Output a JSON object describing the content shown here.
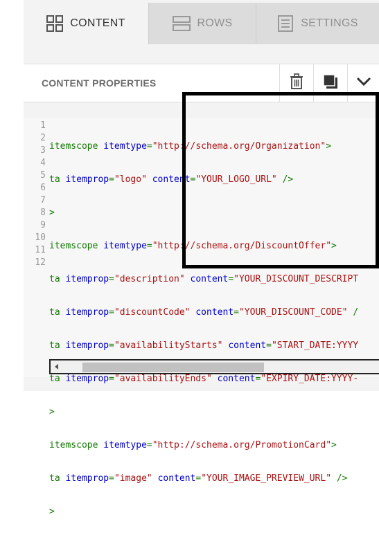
{
  "tabs": [
    {
      "label": "CONTENT",
      "icon": "grid-icon",
      "active": true
    },
    {
      "label": "ROWS",
      "icon": "rows-icon",
      "active": false
    },
    {
      "label": "SETTINGS",
      "icon": "settings-doc-icon",
      "active": false
    }
  ],
  "header": {
    "title": "CONTENT PROPERTIES",
    "buttons": [
      "trash-icon",
      "duplicate-icon",
      "chevron-down-icon"
    ]
  },
  "editor": {
    "line_numbers": [
      "1",
      "2",
      "3",
      "4",
      "5",
      "6",
      "7",
      "8",
      "9",
      "10",
      "11",
      "12"
    ],
    "lines": [
      "itemscope itemtype=\"http://schema.org/Organization\">",
      "ta itemprop=\"logo\" content=\"YOUR_LOGO_URL\" />",
      ">",
      "itemscope itemtype=\"http://schema.org/DiscountOffer\">",
      "ta itemprop=\"description\" content=\"YOUR_DISCOUNT_DESCRIPT",
      "ta itemprop=\"discountCode\" content=\"YOUR_DISCOUNT_CODE\" /",
      "ta itemprop=\"availabilityStarts\" content=\"START_DATE:YYYY",
      "ta itemprop=\"availabilityEnds\" content=\"EXPIRY_DATE:YYYY-",
      ">",
      "itemscope itemtype=\"http://schema.org/PromotionCard\">",
      "ta itemprop=\"image\" content=\"YOUR_IMAGE_PREVIEW_URL\" />",
      ">"
    ]
  },
  "colors": {
    "tag": "#117700",
    "attribute": "#0000cc",
    "string": "#aa1111",
    "annotation_box": "#000000"
  }
}
